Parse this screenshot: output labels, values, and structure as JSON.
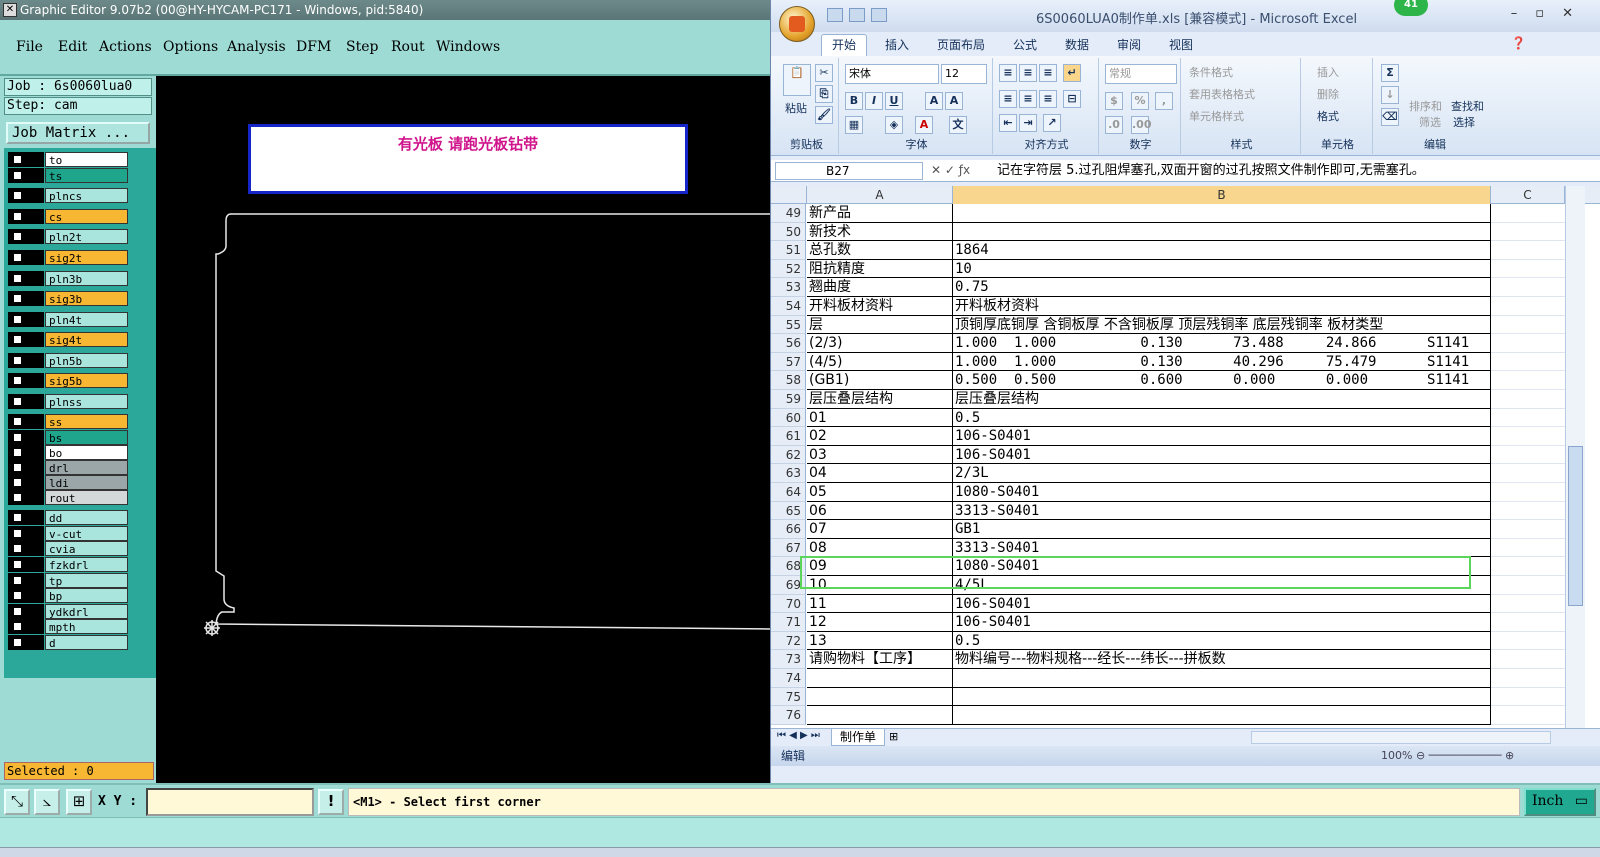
{
  "ge": {
    "title": "Graphic Editor 9.07b2 (00@HY-HYCAM-PC171 - Windows, pid:5840)",
    "menu": [
      "File",
      "Edit",
      "Actions",
      "Options",
      "Analysis",
      "DFM",
      "Step",
      "Rout",
      "Windows"
    ],
    "job": "Job : 6s0060lua0",
    "step": "Step: cam",
    "job_matrix": "Job Matrix ...",
    "layers": [
      {
        "name": "to",
        "color": "#ffffff"
      },
      {
        "name": "ts",
        "color": "#1ea58c"
      },
      {
        "name": "plncs",
        "color": "#a9e4dd"
      },
      {
        "name": "cs",
        "color": "#f7b733"
      },
      {
        "name": "pln2t",
        "color": "#a9e4dd"
      },
      {
        "name": "sig2t",
        "color": "#f7b733"
      },
      {
        "name": "pln3b",
        "color": "#a9e4dd"
      },
      {
        "name": "sig3b",
        "color": "#f7b733"
      },
      {
        "name": "pln4t",
        "color": "#a9e4dd"
      },
      {
        "name": "sig4t",
        "color": "#f7b733"
      },
      {
        "name": "pln5b",
        "color": "#a9e4dd"
      },
      {
        "name": "sig5b",
        "color": "#f7b733"
      },
      {
        "name": "plnss",
        "color": "#a9e4dd"
      },
      {
        "name": "ss",
        "color": "#f7b733"
      },
      {
        "name": "bs",
        "color": "#1ea58c"
      },
      {
        "name": "bo",
        "color": "#ffffff"
      },
      {
        "name": "drl",
        "color": "#9aa6a8"
      },
      {
        "name": "ldi",
        "color": "#9aa6a8"
      },
      {
        "name": "rout",
        "color": "#d4d8d8"
      },
      {
        "name": "dd",
        "color": "#a9e4dd"
      },
      {
        "name": "v-cut",
        "color": "#a9e4dd"
      },
      {
        "name": "cvia",
        "color": "#a9e4dd"
      },
      {
        "name": "fzkdrl",
        "color": "#a9e4dd"
      },
      {
        "name": "tp",
        "color": "#a9e4dd"
      },
      {
        "name": "bp",
        "color": "#a9e4dd"
      },
      {
        "name": "ydkdrl",
        "color": "#a9e4dd"
      },
      {
        "name": "mpth",
        "color": "#a9e4dd"
      },
      {
        "name": "d",
        "color": "#a9e4dd"
      }
    ],
    "selected": "Selected : 0",
    "canvas_note": "有光板  请跑光板钻带",
    "xy_label": "X Y :",
    "xy_value": "",
    "prompt": "<M1> - Select first corner",
    "units": "Inch"
  },
  "excel": {
    "title": "6S0060LUA0制作单.xls  [兼容模式] - Microsoft Excel",
    "badge": "41",
    "tabs": [
      "开始",
      "插入",
      "页面布局",
      "公式",
      "数据",
      "审阅",
      "视图"
    ],
    "groups": {
      "clipboard": "剪贴板",
      "font": "字体",
      "align": "对齐方式",
      "number": "数字",
      "style": "样式",
      "cells": "单元格",
      "edit": "编辑"
    },
    "paste": "粘贴",
    "font_name": "宋体",
    "font_size": "12",
    "number_format": "常规",
    "style_items": [
      "条件格式",
      "套用表格格式",
      "单元格样式"
    ],
    "cell_items": [
      "插入",
      "删除",
      "格式"
    ],
    "edit_items": [
      "排序和",
      "筛选",
      "查找和",
      "选择"
    ],
    "name_box": "B27",
    "formula": "记在字符层 5.过孔阻焊塞孔,双面开窗的过孔按照文件制作即可,无需塞孔。",
    "col_headers": [
      "A",
      "B",
      "C"
    ],
    "rows": [
      {
        "n": "49",
        "a": "新产品",
        "b": ""
      },
      {
        "n": "50",
        "a": "新技术",
        "b": ""
      },
      {
        "n": "51",
        "a": "总孔数",
        "b": "1864"
      },
      {
        "n": "52",
        "a": "阻抗精度",
        "b": "10"
      },
      {
        "n": "53",
        "a": "翘曲度",
        "b": "0.75"
      },
      {
        "n": "54",
        "a": "开料板材资料",
        "b": "开料板材资料"
      },
      {
        "n": "55",
        "a": "层",
        "b": "顶铜厚底铜厚 含铜板厚 不含铜板厚 顶层残铜率 底层残铜率 板材类型"
      },
      {
        "n": "56",
        "a": "(2/3)",
        "b": "1.000  1.000          0.130      73.488     24.866      S1141"
      },
      {
        "n": "57",
        "a": "(4/5)",
        "b": "1.000  1.000          0.130      40.296     75.479      S1141"
      },
      {
        "n": "58",
        "a": "(GB1)",
        "b": "0.500  0.500          0.600      0.000      0.000       S1141"
      },
      {
        "n": "59",
        "a": "层压叠层结构",
        "b": "层压叠层结构"
      },
      {
        "n": "60",
        "a": "01",
        "b": "0.5"
      },
      {
        "n": "61",
        "a": "02",
        "b": "106-S0401"
      },
      {
        "n": "62",
        "a": "03",
        "b": "106-S0401"
      },
      {
        "n": "63",
        "a": "04",
        "b": "2/3L"
      },
      {
        "n": "64",
        "a": "05",
        "b": "1080-S0401"
      },
      {
        "n": "65",
        "a": "06",
        "b": "3313-S0401"
      },
      {
        "n": "66",
        "a": "07",
        "b": "GB1"
      },
      {
        "n": "67",
        "a": "08",
        "b": "3313-S0401"
      },
      {
        "n": "68",
        "a": "09",
        "b": "1080-S0401"
      },
      {
        "n": "69",
        "a": "10",
        "b": "4/5L"
      },
      {
        "n": "70",
        "a": "11",
        "b": "106-S0401"
      },
      {
        "n": "71",
        "a": "12",
        "b": "106-S0401"
      },
      {
        "n": "72",
        "a": "13",
        "b": "0.5"
      },
      {
        "n": "73",
        "a": "请购物料【工序】",
        "b": "物料编号---物料规格---经长---纬长---拼板数"
      },
      {
        "n": "74",
        "a": "",
        "b": ""
      },
      {
        "n": "75",
        "a": "",
        "b": ""
      },
      {
        "n": "76",
        "a": "",
        "b": ""
      }
    ],
    "sheet_tab": "制作单",
    "status": "编辑",
    "zoom": "100%"
  }
}
